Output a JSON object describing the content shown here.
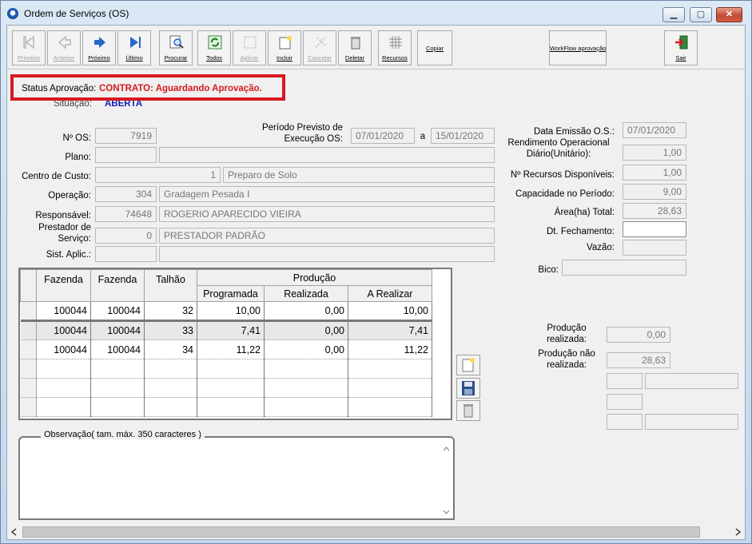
{
  "window": {
    "title": "Ordem de Serviços (OS)"
  },
  "toolbar": {
    "buttons": [
      {
        "label": "Primeiro",
        "enabled": false
      },
      {
        "label": "Anterior",
        "enabled": false
      },
      {
        "label": "Próximo",
        "enabled": true
      },
      {
        "label": "Último",
        "enabled": true
      },
      {
        "label": "Procurar",
        "enabled": true
      },
      {
        "label": "Todos",
        "enabled": true
      },
      {
        "label": "Aplicar",
        "enabled": false
      },
      {
        "label": "Incluir",
        "enabled": true
      },
      {
        "label": "Cancelar",
        "enabled": false
      },
      {
        "label": "Deletar",
        "enabled": true
      },
      {
        "label": "Recursos",
        "enabled": true
      },
      {
        "label": "Copiar",
        "enabled": true
      }
    ],
    "workflow_label": "WorkFlow aprovação",
    "exit_label": "Sair"
  },
  "status": {
    "label": "Status Aprovação:",
    "value": "CONTRATO: Aguardando Aprovação.",
    "color": "#d71920"
  },
  "situacao": {
    "label": "Situação:",
    "value": "ABERTA"
  },
  "form": {
    "os_label": "Nº OS:",
    "os_value": "7919",
    "periodo_label": "Período Previsto de Execução OS:",
    "periodo_start": "07/01/2020",
    "periodo_sep": "a",
    "periodo_end": "15/01/2020",
    "plano_label": "Plano:",
    "centro_label": "Centro de Custo:",
    "centro_code": "1",
    "centro_name": "Preparo de Solo",
    "operacao_label": "Operação:",
    "operacao_code": "304",
    "operacao_name": "Gradagem Pesada I",
    "responsavel_label": "Responsável:",
    "responsavel_code": "74648",
    "responsavel_name": "ROGERIO APARECIDO VIEIRA",
    "prestador_label": "Prestador de Serviço:",
    "prestador_code": "0",
    "prestador_name": "PRESTADOR PADRÃO",
    "sist_label": "Sist. Aplic.:"
  },
  "right_panel": {
    "emissao_label": "Data Emissão O.S.:",
    "emissao_value": "07/01/2020",
    "rendimento_label": "Rendimento Operacional Diário(Unitário):",
    "rendimento_value": "1,00",
    "recursos_label": "Nº Recursos Disponíveis:",
    "recursos_value": "1,00",
    "capacidade_label": "Capacidade no Período:",
    "capacidade_value": "9,00",
    "area_label": "Área(ha) Total:",
    "area_value": "28,63",
    "fechamento_label": "Dt. Fechamento:",
    "vazao_label": "Vazão:",
    "bico_label": "Bico:",
    "prod_realizada_label": "Produção realizada:",
    "prod_realizada_value": "0,00",
    "prod_nao_label": "Produção não realizada:",
    "prod_nao_value": "28,63"
  },
  "grid": {
    "headers": {
      "fazenda1": "Fazenda",
      "fazenda2": "Fazenda",
      "talhao": "Talhão",
      "producao": "Produção",
      "programada": "Programada",
      "realizada": "Realizada",
      "a_realizar": "A Realizar"
    },
    "rows": [
      [
        "100044",
        "100044",
        "32",
        "10,00",
        "0,00",
        "10,00"
      ],
      [
        "100044",
        "100044",
        "33",
        "7,41",
        "0,00",
        "7,41"
      ],
      [
        "100044",
        "100044",
        "34",
        "11,22",
        "0,00",
        "11,22"
      ]
    ]
  },
  "observacao": {
    "label": "Observação( tam. máx. 350 caracteres )"
  }
}
